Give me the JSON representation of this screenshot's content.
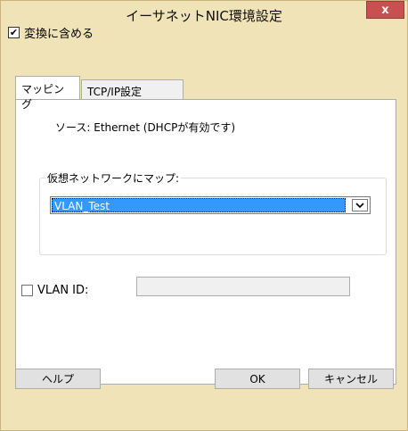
{
  "window": {
    "title": "イーサネットNIC環境設定",
    "close_label": "x"
  },
  "convert": {
    "checked": true,
    "check_glyph": "✔",
    "label": "変換に含める"
  },
  "tabs": [
    {
      "label": "マッピング",
      "active": true
    },
    {
      "label": "TCP/IP設定",
      "active": false
    }
  ],
  "mapping": {
    "source_text": "ソース: Ethernet (DHCPが有効です)",
    "group_label": "仮想ネットワークにマップ:",
    "network_value": "VLAN_Test"
  },
  "vlan": {
    "checked": false,
    "label": "VLAN ID:",
    "value": ""
  },
  "buttons": {
    "help": "ヘルプ",
    "ok": "OK",
    "cancel": "キャンセル"
  }
}
